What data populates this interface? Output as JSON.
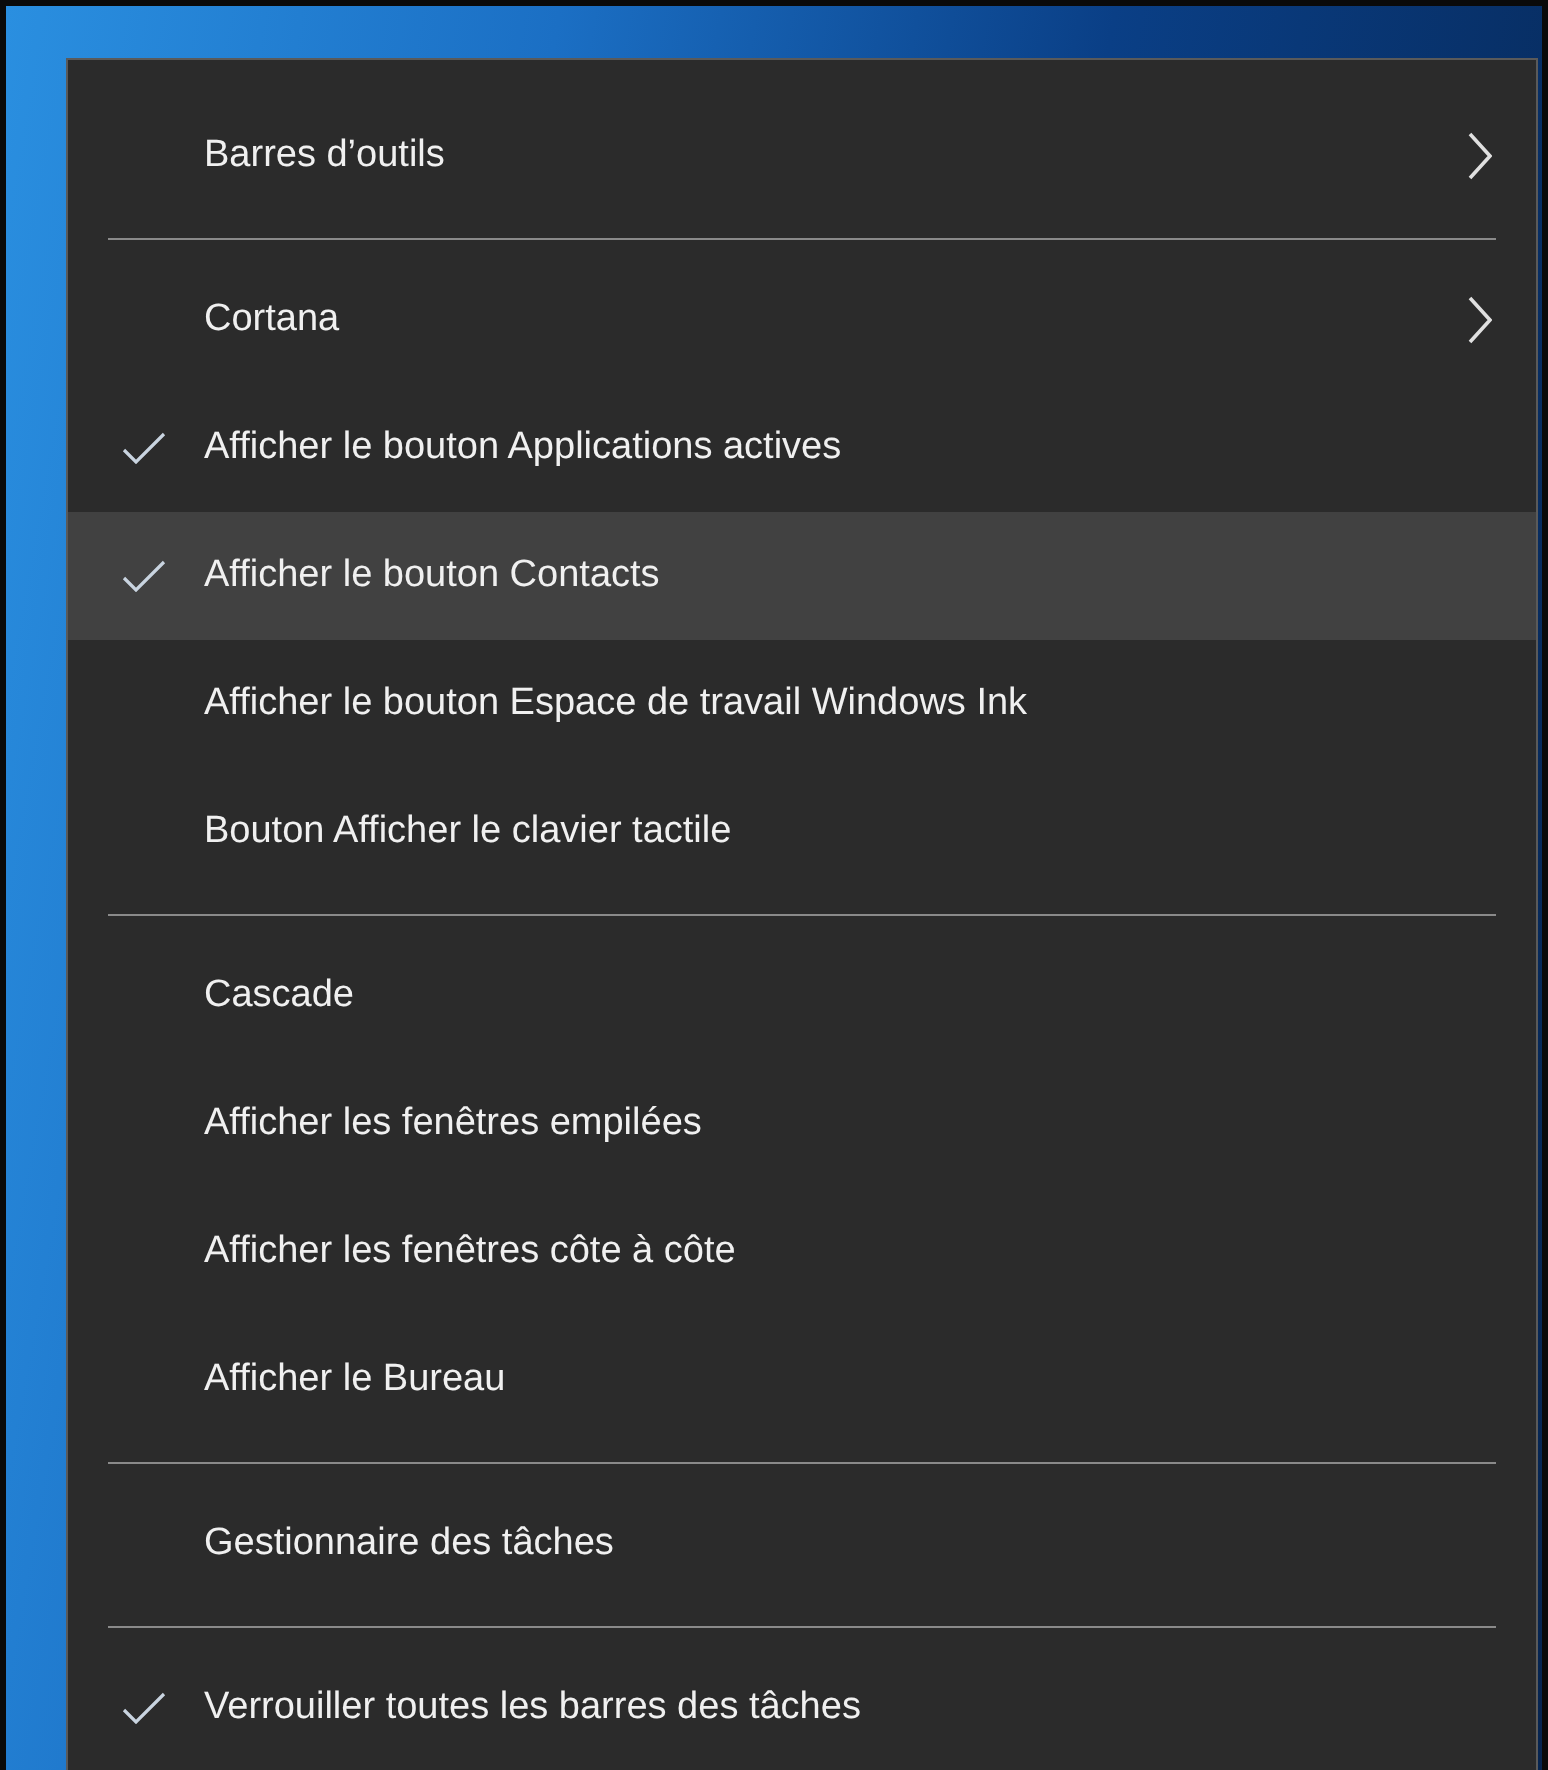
{
  "menu": {
    "items": [
      {
        "kind": "item",
        "label": "Barres d’outils",
        "checked": false,
        "selected": false,
        "submenu": true
      },
      {
        "kind": "separator"
      },
      {
        "kind": "item",
        "label": "Cortana",
        "checked": false,
        "selected": false,
        "submenu": true
      },
      {
        "kind": "item",
        "label": "Afficher le bouton Applications actives",
        "checked": true,
        "selected": false,
        "submenu": false
      },
      {
        "kind": "item",
        "label": "Afficher le bouton Contacts",
        "checked": true,
        "selected": true,
        "submenu": false
      },
      {
        "kind": "item",
        "label": "Afficher le bouton Espace de travail Windows Ink",
        "checked": false,
        "selected": false,
        "submenu": false
      },
      {
        "kind": "item",
        "label": "Bouton Afficher le clavier tactile",
        "checked": false,
        "selected": false,
        "submenu": false
      },
      {
        "kind": "separator"
      },
      {
        "kind": "item",
        "label": "Cascade",
        "checked": false,
        "selected": false,
        "submenu": false
      },
      {
        "kind": "item",
        "label": "Afficher les fenêtres empilées",
        "checked": false,
        "selected": false,
        "submenu": false
      },
      {
        "kind": "item",
        "label": "Afficher les fenêtres côte à côte",
        "checked": false,
        "selected": false,
        "submenu": false
      },
      {
        "kind": "item",
        "label": "Afficher le Bureau",
        "checked": false,
        "selected": false,
        "submenu": false
      },
      {
        "kind": "separator"
      },
      {
        "kind": "item",
        "label": "Gestionnaire des tâches",
        "checked": false,
        "selected": false,
        "submenu": false
      },
      {
        "kind": "separator"
      },
      {
        "kind": "item",
        "label": "Verrouiller toutes les barres des tâches",
        "checked": true,
        "selected": false,
        "submenu": false
      }
    ]
  }
}
